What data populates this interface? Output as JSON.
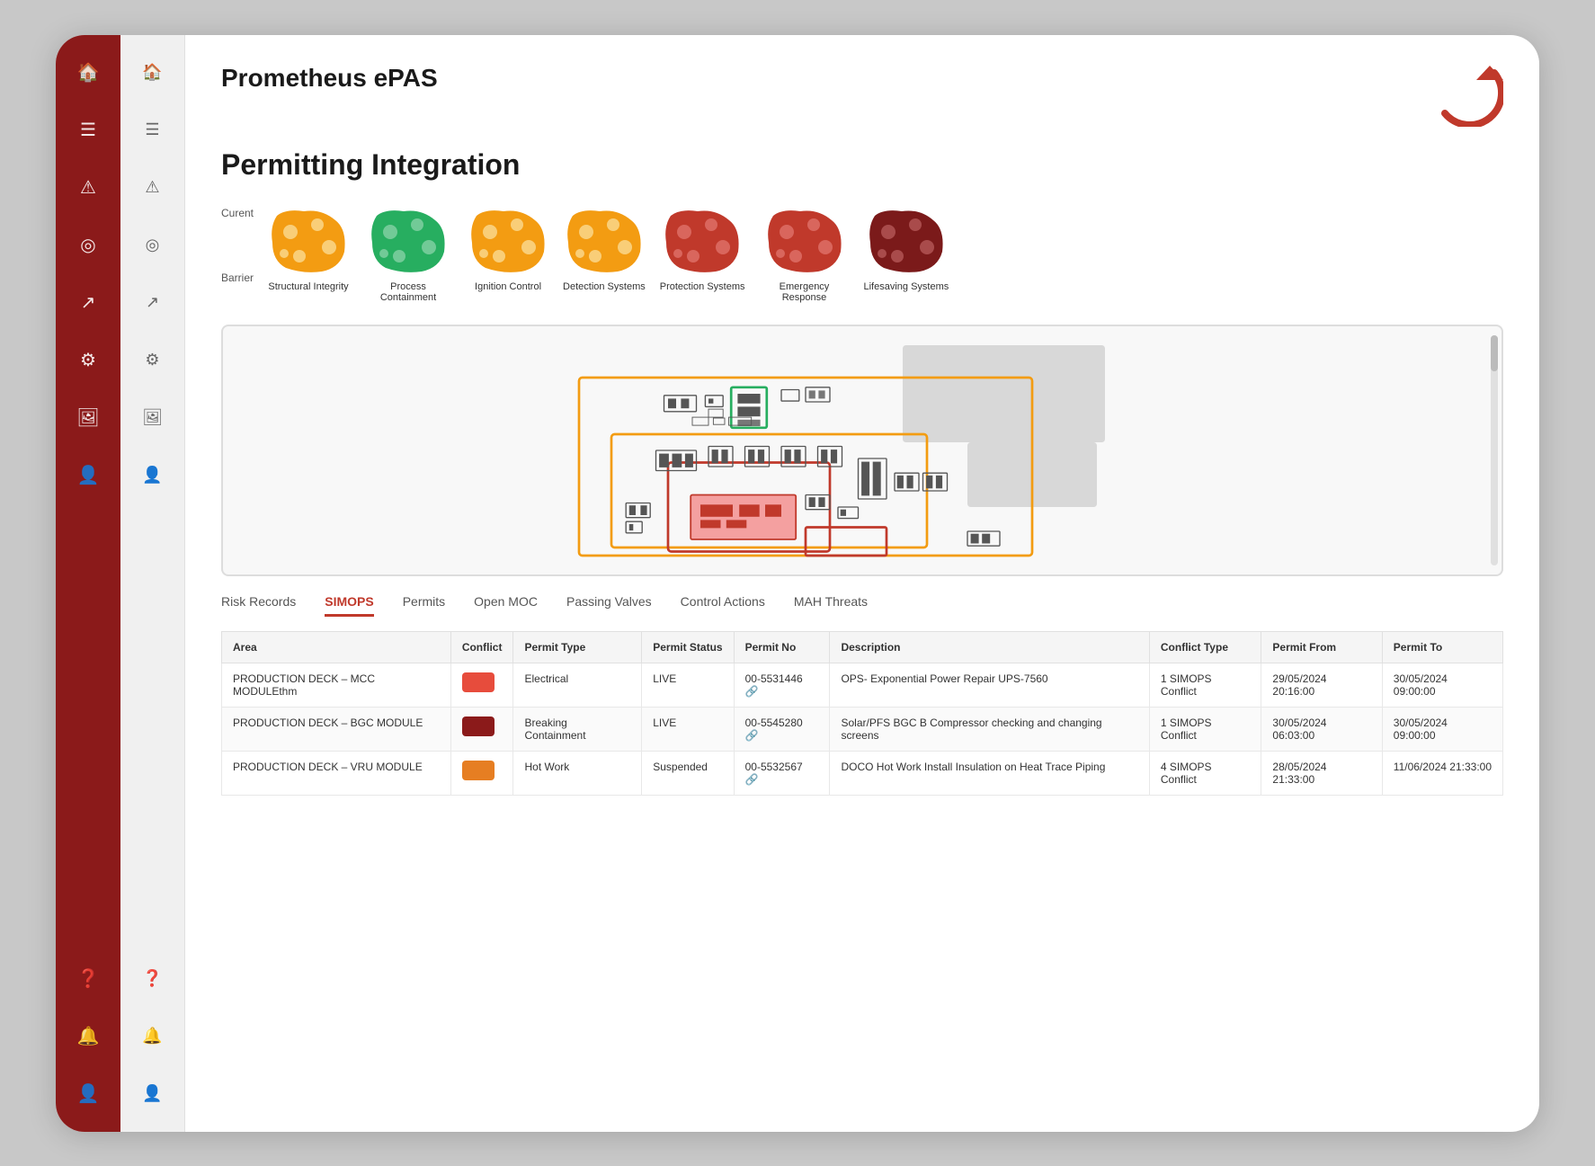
{
  "app": {
    "title": "Prometheus ePAS"
  },
  "page": {
    "title": "Permitting Integration"
  },
  "sidebar_left": {
    "icons": [
      "home",
      "menu",
      "warning",
      "check-circle",
      "trending-up",
      "settings-circle",
      "image",
      "person"
    ]
  },
  "sidebar_inner": {
    "icons": [
      "home",
      "menu",
      "warning",
      "check-circle",
      "trending-up",
      "settings-circle",
      "image",
      "person"
    ]
  },
  "barrier_row": {
    "current_label": "Curent",
    "barrier_label": "Barrier",
    "items": [
      {
        "label": "Structural Integrity",
        "color": "orange"
      },
      {
        "label": "Process Containment",
        "color": "green"
      },
      {
        "label": "Ignition Control",
        "color": "orange"
      },
      {
        "label": "Detection Systems",
        "color": "orange"
      },
      {
        "label": "Protection Systems",
        "color": "red"
      },
      {
        "label": "Emergency Response",
        "color": "red"
      },
      {
        "label": "Lifesaving Systems",
        "color": "dark-red"
      }
    ]
  },
  "tabs": [
    {
      "label": "Risk Records",
      "active": false
    },
    {
      "label": "SIMOPS",
      "active": true
    },
    {
      "label": "Permits",
      "active": false
    },
    {
      "label": "Open MOC",
      "active": false
    },
    {
      "label": "Passing Valves",
      "active": false
    },
    {
      "label": "Control Actions",
      "active": false
    },
    {
      "label": "MAH Threats",
      "active": false
    }
  ],
  "table": {
    "columns": [
      "Area",
      "Conflict",
      "Permit Type",
      "Permit  Status",
      "Permit  No",
      "Description",
      "Conflict Type",
      "Permit From",
      "Permit  To"
    ],
    "rows": [
      {
        "area": "PRODUCTION DECK – MCC MODULEthm",
        "conflict_color": "red",
        "permit_type": "Electrical",
        "permit_status": "LIVE",
        "permit_no": "00-5531446",
        "description": "OPS- Exponential Power Repair UPS-7560",
        "conflict_type": "1 SIMOPS Conflict",
        "permit_from": "29/05/2024 20:16:00",
        "permit_to": "30/05/2024 09:00:00"
      },
      {
        "area": "PRODUCTION DECK – BGC MODULE",
        "conflict_color": "dark-red",
        "permit_type": "Breaking Containment",
        "permit_status": "LIVE",
        "permit_no": "00-5545280",
        "description": "Solar/PFS BGC B Compressor checking and changing screens",
        "conflict_type": "1 SIMOPS Conflict",
        "permit_from": "30/05/2024 06:03:00",
        "permit_to": "30/05/2024 09:00:00"
      },
      {
        "area": "PRODUCTION DECK – VRU MODULE",
        "conflict_color": "orange",
        "permit_type": "Hot Work",
        "permit_status": "Suspended",
        "permit_no": "00-5532567",
        "description": "DOCO Hot Work Install Insulation on Heat Trace Piping",
        "conflict_type": "4 SIMOPS Conflict",
        "permit_from": "28/05/2024 21:33:00",
        "permit_to": "11/06/2024 21:33:00"
      }
    ]
  }
}
